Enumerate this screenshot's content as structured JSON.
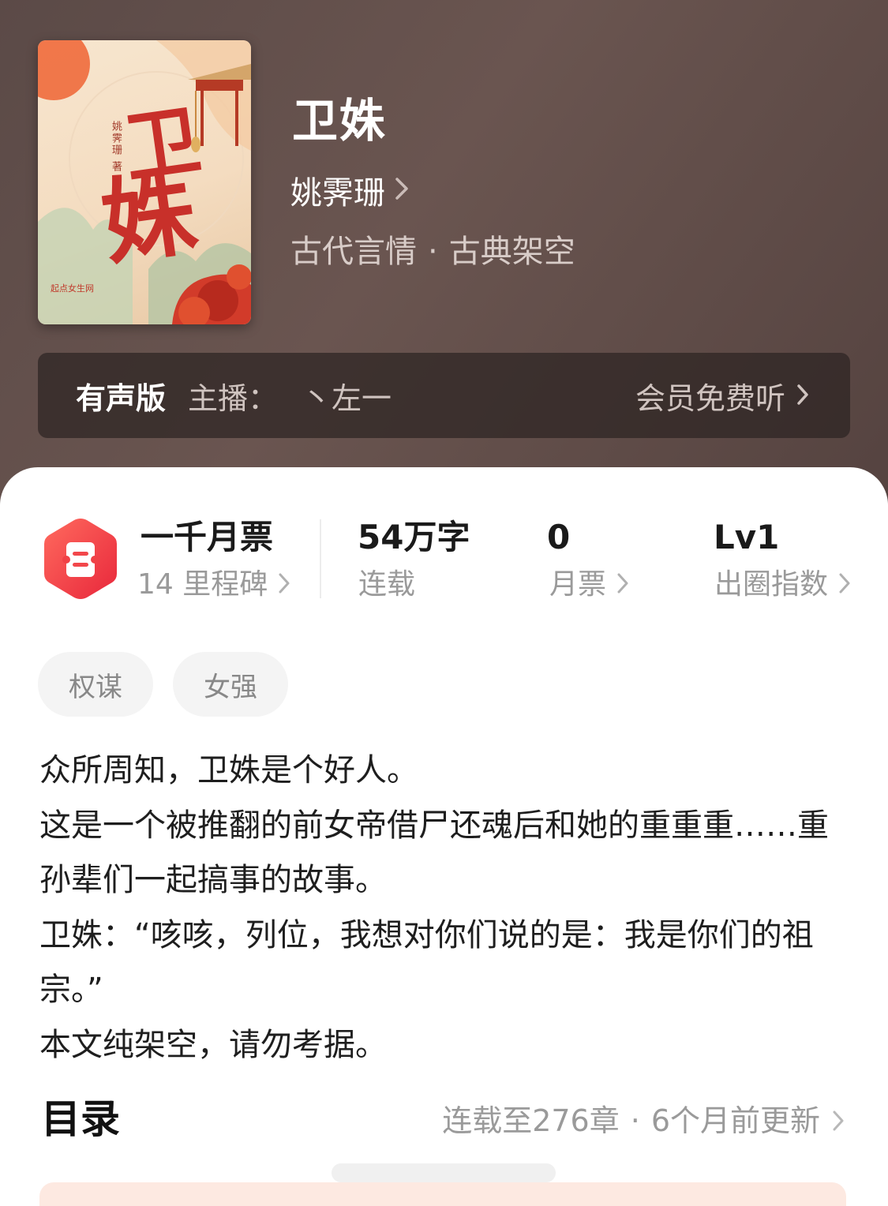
{
  "book": {
    "title": "卫姝",
    "author": "姚霁珊",
    "genre": "古代言情",
    "subgenre": "古典架空",
    "cover": {
      "title_chars": [
        "卫",
        "姝"
      ],
      "author_line": "姚霁珊 著",
      "publisher": "起点女生网"
    }
  },
  "audio": {
    "label": "有声版",
    "host_label": "主播：",
    "host_name": "丶左一",
    "action": "会员免费听"
  },
  "stats": {
    "milestone_title": "一千月票",
    "milestone_sub": "14 里程碑",
    "words_value": "54",
    "words_unit": "万字",
    "words_sub": "连载",
    "monthly_votes_value": "0",
    "monthly_votes_sub": "月票",
    "reach_value": "Lv1",
    "reach_sub": "出圈指数"
  },
  "tags": [
    "权谋",
    "女强"
  ],
  "synopsis": [
    "众所周知，卫姝是个好人。",
    "这是一个被推翻的前女帝借尸还魂后和她的重重重……重孙辈们一起搞事的故事。",
    "卫姝：“咳咳，列位，我想对你们说的是：我是你们的祖宗。”",
    "本文纯架空，请勿考据。"
  ],
  "toc": {
    "title": "目录",
    "status": "连载至276章",
    "updated": "6个月前更新"
  },
  "colors": {
    "hero_bg": "#5b4a47",
    "badge_red": "#f2474b",
    "cover_red": "#c8302a"
  }
}
